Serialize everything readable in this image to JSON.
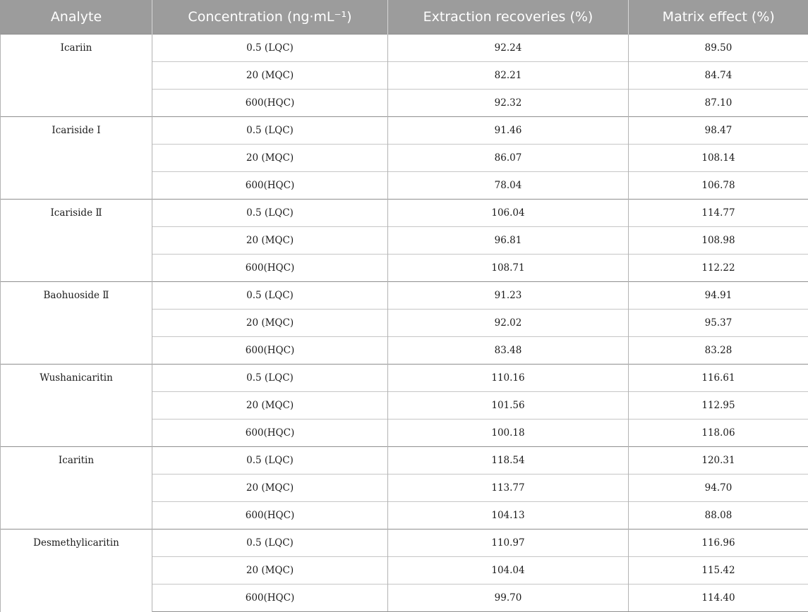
{
  "table": {
    "headers": [
      "Analyte",
      "Concentration (ng·mL⁻¹)",
      "Extraction recoveries (%)",
      "Matrix effect (%)"
    ],
    "groups": [
      {
        "analyte": "Icariin",
        "rows": [
          [
            "0.5 (LQC)",
            "92.24",
            "89.50"
          ],
          [
            "20 (MQC)",
            "82.21",
            "84.74"
          ],
          [
            "600(HQC)",
            "92.32",
            "87.10"
          ]
        ]
      },
      {
        "analyte": "Icariside Ⅰ",
        "rows": [
          [
            "0.5 (LQC)",
            "91.46",
            "98.47"
          ],
          [
            "20 (MQC)",
            "86.07",
            "108.14"
          ],
          [
            "600(HQC)",
            "78.04",
            "106.78"
          ]
        ]
      },
      {
        "analyte": "Icariside Ⅱ",
        "rows": [
          [
            "0.5 (LQC)",
            "106.04",
            "114.77"
          ],
          [
            "20 (MQC)",
            "96.81",
            "108.98"
          ],
          [
            "600(HQC)",
            "108.71",
            "112.22"
          ]
        ]
      },
      {
        "analyte": "Baohuoside Ⅱ",
        "rows": [
          [
            "0.5 (LQC)",
            "91.23",
            "94.91"
          ],
          [
            "20 (MQC)",
            "92.02",
            "95.37"
          ],
          [
            "600(HQC)",
            "83.48",
            "83.28"
          ]
        ]
      },
      {
        "analyte": "Wushanicaritin",
        "rows": [
          [
            "0.5 (LQC)",
            "110.16",
            "116.61"
          ],
          [
            "20 (MQC)",
            "101.56",
            "112.95"
          ],
          [
            "600(HQC)",
            "100.18",
            "118.06"
          ]
        ]
      },
      {
        "analyte": "Icaritin",
        "rows": [
          [
            "0.5 (LQC)",
            "118.54",
            "120.31"
          ],
          [
            "20 (MQC)",
            "113.77",
            "94.70"
          ],
          [
            "600(HQC)",
            "104.13",
            "88.08"
          ]
        ]
      },
      {
        "analyte": "Desmethylicaritin",
        "rows": [
          [
            "0.5 (LQC)",
            "110.97",
            "116.96"
          ],
          [
            "20 (MQC)",
            "104.04",
            "115.42"
          ],
          [
            "600(HQC)",
            "99.70",
            "114.40"
          ]
        ]
      }
    ]
  }
}
